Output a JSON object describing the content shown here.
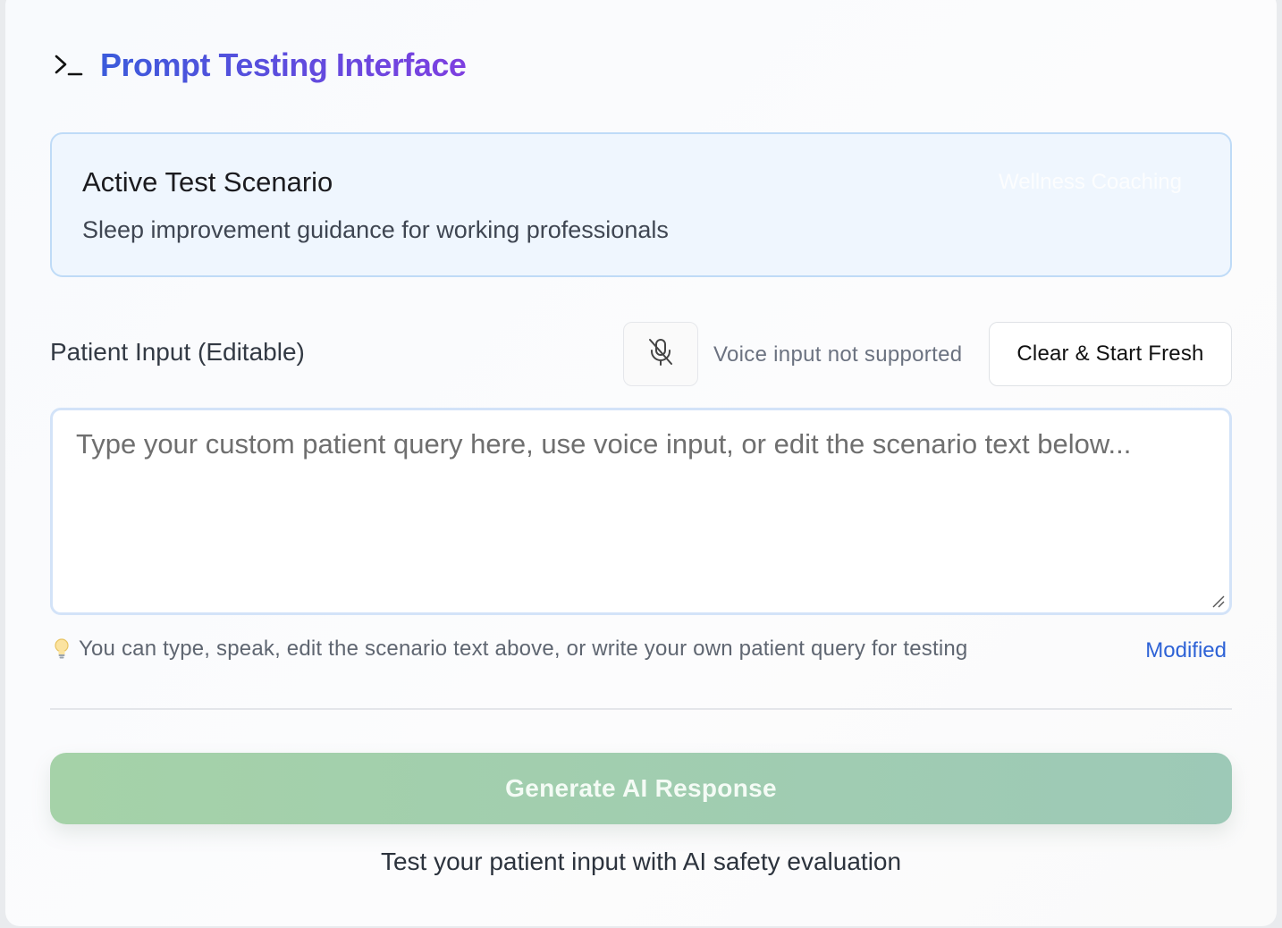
{
  "header": {
    "title": "Prompt Testing Interface",
    "icon": "terminal-icon"
  },
  "scenario": {
    "heading": "Active Test Scenario",
    "tag": "Wellness Coaching",
    "description": "Sleep improvement guidance for working professionals"
  },
  "input": {
    "label": "Patient Input (Editable)",
    "mic_icon": "mic-off-icon",
    "voice_status": "Voice input not supported",
    "clear_label": "Clear & Start Fresh",
    "placeholder": "Type your custom patient query here, use voice input, or edit the scenario text below...",
    "value": ""
  },
  "hint": {
    "icon": "lightbulb-icon",
    "text": "You can type, speak, edit the scenario text above, or write your own patient query for testing",
    "status": "Modified"
  },
  "actions": {
    "generate_label": "Generate AI Response",
    "note": "Test your patient input with AI safety evaluation"
  },
  "colors": {
    "title_gradient_start": "#3b5bdb",
    "title_gradient_end": "#7e3fe0",
    "scenario_bg": "#eff6fe",
    "scenario_border": "#bfdbf7",
    "modified": "#2d62d6",
    "generate_gradient_start": "#a5d2a8",
    "generate_gradient_end": "#9dc9b7"
  }
}
